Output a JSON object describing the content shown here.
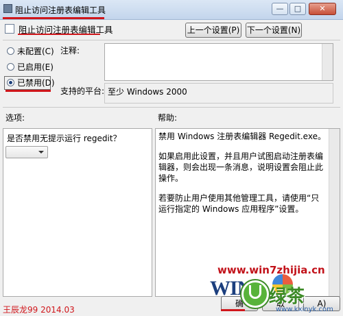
{
  "window": {
    "title": "阻止访问注册表编辑工具",
    "controls": {
      "minimize": "—",
      "maximize": "□",
      "close": "✕"
    }
  },
  "header": {
    "setting_name": "阻止访问注册表编辑工具",
    "prev_button": "上一个设置(P)",
    "next_button": "下一个设置(N)"
  },
  "options": {
    "not_configured": "未配置(C)",
    "enabled": "已启用(E)",
    "disabled": "已禁用(D)",
    "selected": "disabled"
  },
  "comment_label": "注释:",
  "supported_label": "支持的平台:",
  "supported_value": "至少 Windows 2000",
  "options_label": "选项:",
  "help_label": "帮助:",
  "option_question": "是否禁用无提示运行 regedit？",
  "dropdown_value": "",
  "help_text": [
    "禁用 Windows 注册表编辑器 Regedit.exe。",
    "如果启用此设置，并且用户试图启动注册表编辑器，则会出现一条消息，说明设置会阻止此操作。",
    "若要防止用户使用其他管理工具，请使用“只运行指定的 Windows 应用程序”设置。"
  ],
  "footer": {
    "ok_button": "确",
    "cancel_button": "取",
    "apply_button": "A)"
  },
  "watermark": {
    "site": "www.win7zhijia.cn",
    "logo": "WIN7",
    "brand": "绿茶",
    "url": "www.kxinyk.com"
  },
  "credit": "王辰龙99 2014.03",
  "colors": {
    "accent_red": "#d0161b",
    "titlebar": "#c3d5ec"
  }
}
